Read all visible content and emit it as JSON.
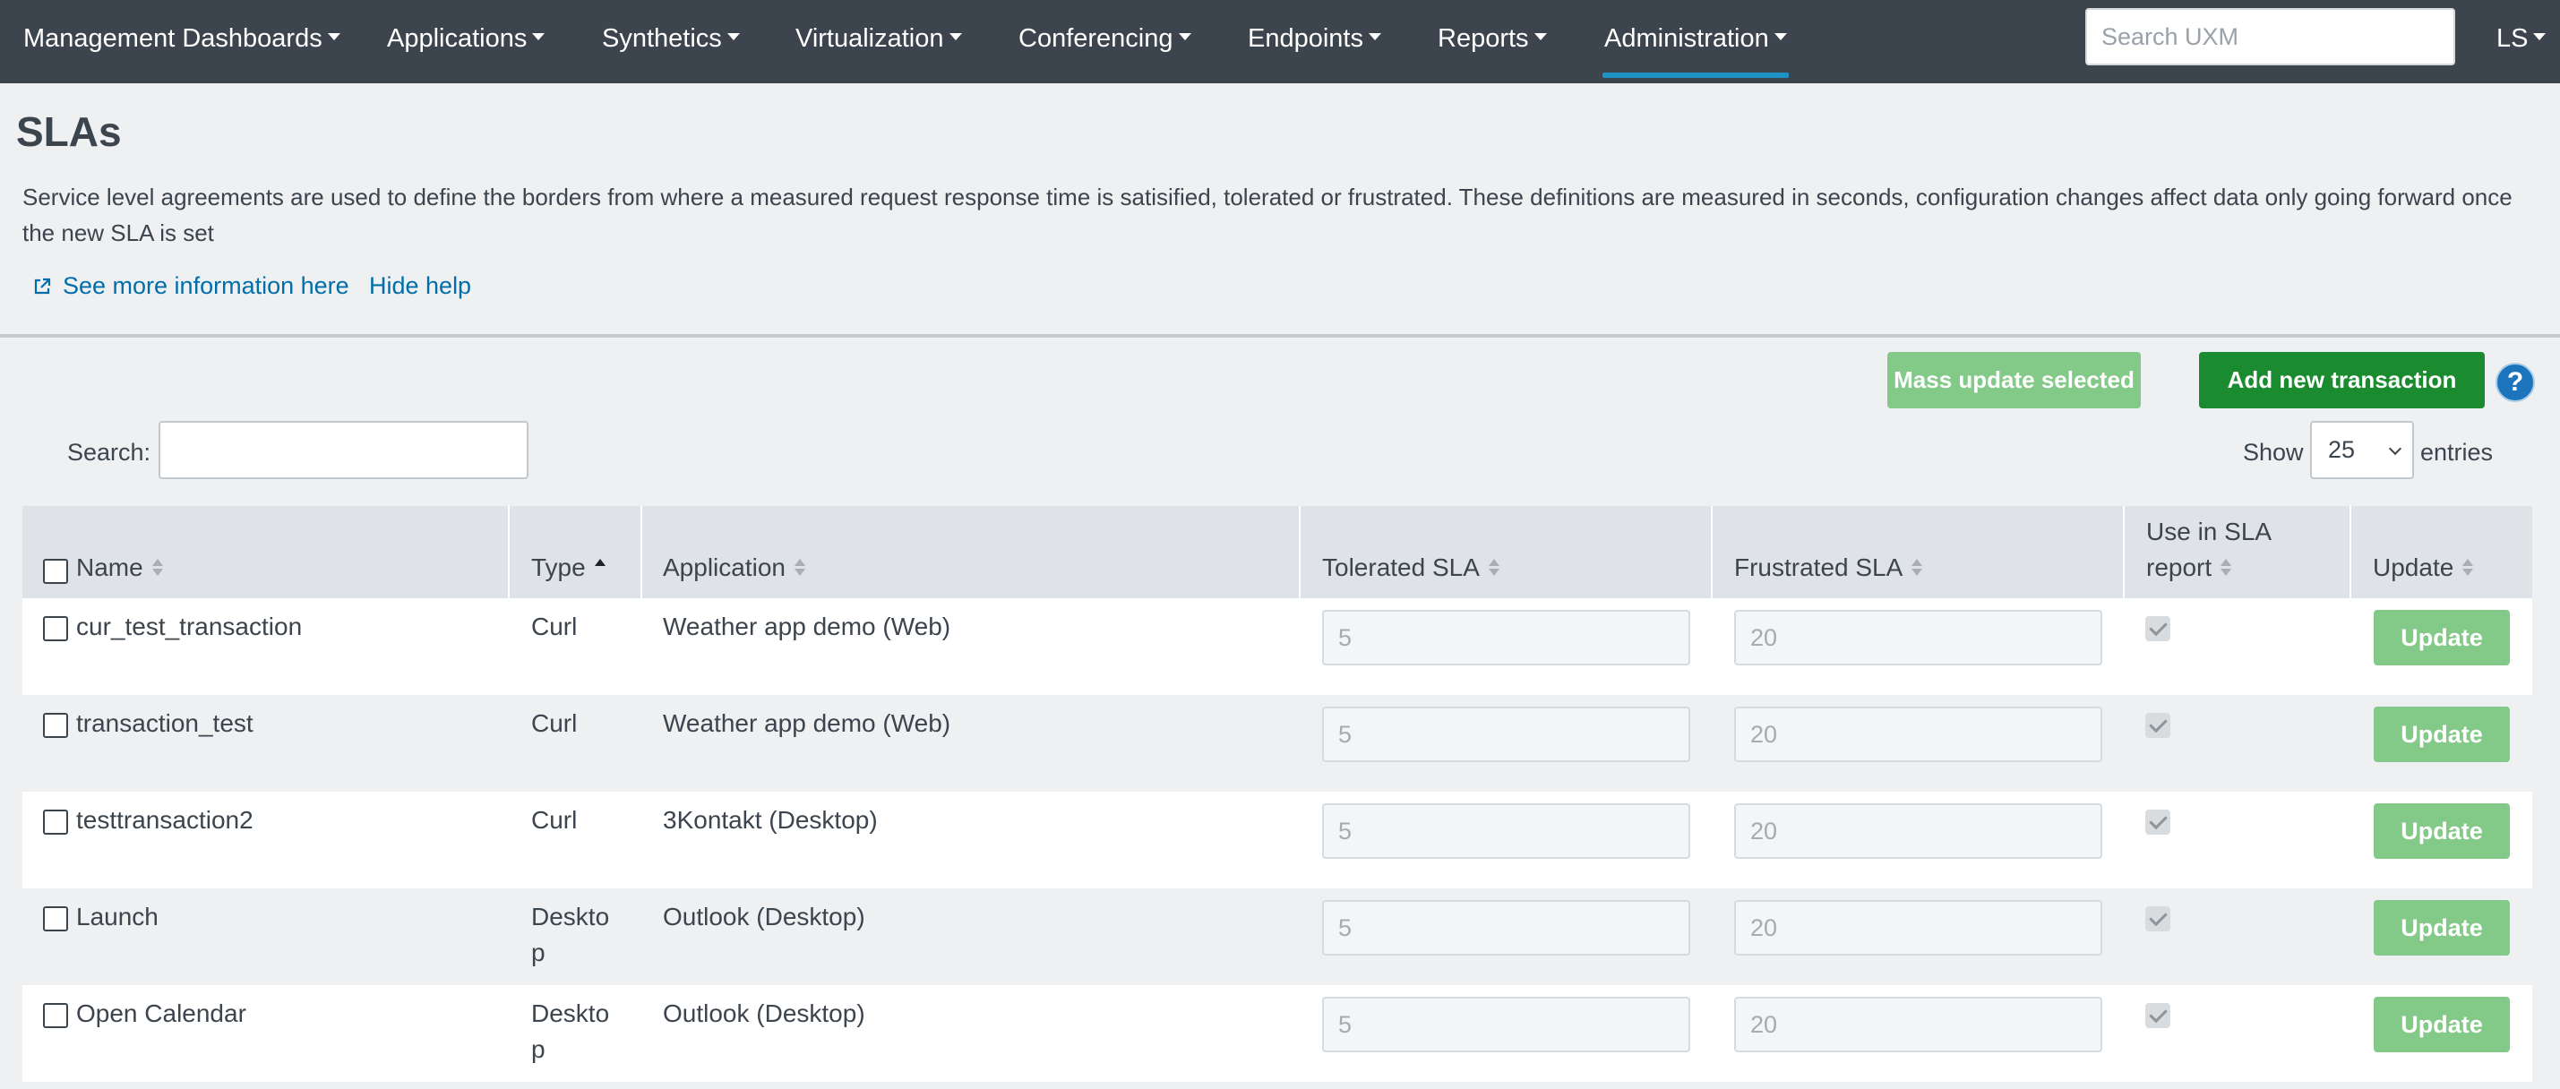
{
  "nav": {
    "items": [
      {
        "label": "Management Dashboards",
        "active": false
      },
      {
        "label": "Applications",
        "active": false
      },
      {
        "label": "Synthetics",
        "active": false
      },
      {
        "label": "Virtualization",
        "active": false
      },
      {
        "label": "Conferencing",
        "active": false
      },
      {
        "label": "Endpoints",
        "active": false
      },
      {
        "label": "Reports",
        "active": false
      },
      {
        "label": "Administration",
        "active": true
      }
    ],
    "search_placeholder": "Search UXM",
    "user": "LS"
  },
  "page": {
    "title": "SLAs",
    "help_text": "Service level agreements are used to define the borders from where a measured request response time is satisified, tolerated or frustrated. These definitions are measured in seconds, configuration changes affect data only going forward once the new SLA is set",
    "see_more_link": "See more information here",
    "hide_help_link": "Hide help"
  },
  "toolbar": {
    "mass_update_label": "Mass update selected",
    "add_new_label": "Add new transaction",
    "help_glyph": "?",
    "search_label": "Search:",
    "show_label": "Show",
    "entries_value": "25",
    "entries_label": "entries"
  },
  "table": {
    "columns": {
      "name": "Name",
      "type": "Type",
      "application": "Application",
      "tolerated": "Tolerated SLA",
      "frustrated": "Frustrated SLA",
      "use_in_report": "Use in SLA report",
      "update": "Update"
    },
    "sorted_column": "type",
    "rows": [
      {
        "name": "cur_test_transaction",
        "type": "Curl",
        "application": "Weather app demo (Web)",
        "tolerated": "5",
        "frustrated": "20",
        "use_in_report": true,
        "update_label": "Update"
      },
      {
        "name": "transaction_test",
        "type": "Curl",
        "application": "Weather app demo (Web)",
        "tolerated": "5",
        "frustrated": "20",
        "use_in_report": true,
        "update_label": "Update"
      },
      {
        "name": "testtransaction2",
        "type": "Curl",
        "application": "3Kontakt (Desktop)",
        "tolerated": "5",
        "frustrated": "20",
        "use_in_report": true,
        "update_label": "Update"
      },
      {
        "name": "Launch",
        "type": "Deskto\np",
        "application": "Outlook (Desktop)",
        "tolerated": "5",
        "frustrated": "20",
        "use_in_report": true,
        "update_label": "Update"
      },
      {
        "name": "Open Calendar",
        "type": "Deskto\np",
        "application": "Outlook (Desktop)",
        "tolerated": "5",
        "frustrated": "20",
        "use_in_report": true,
        "update_label": "Update"
      }
    ]
  },
  "colors": {
    "nav_bg": "#3c444d",
    "accent_underline": "#1e93c6",
    "primary_green": "#1a8c2f",
    "disabled_green": "#83c988",
    "link_blue": "#006eaa"
  }
}
